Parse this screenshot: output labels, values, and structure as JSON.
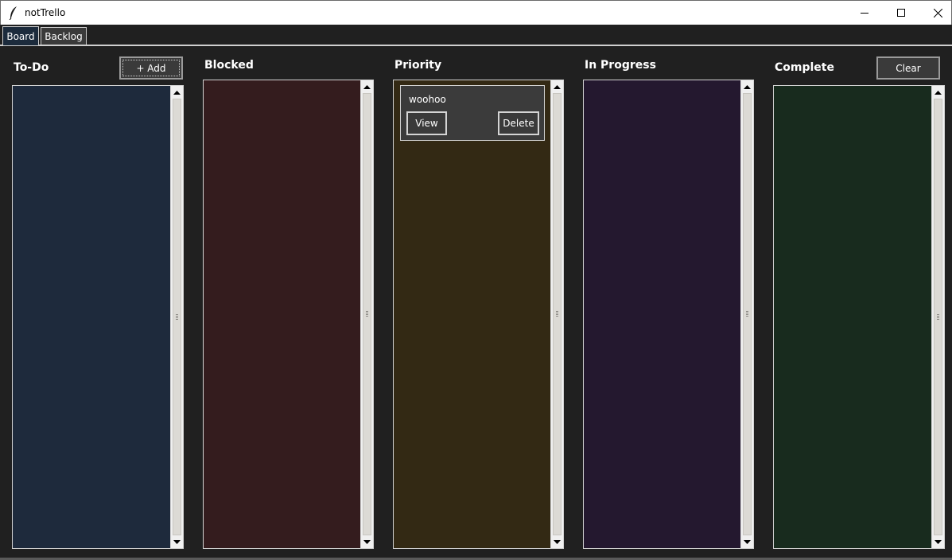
{
  "window": {
    "title": "notTrello",
    "controls": {
      "minimize": "minimize-icon",
      "maximize": "maximize-icon",
      "close": "close-icon"
    }
  },
  "tabs": [
    {
      "label": "Board",
      "selected": true
    },
    {
      "label": "Backlog",
      "selected": false
    }
  ],
  "columns": [
    {
      "title": "To-Do",
      "color": "#1e2a3c",
      "button": "+ Add",
      "cards": []
    },
    {
      "title": "Blocked",
      "color": "#341c1e",
      "cards": []
    },
    {
      "title": "Priority",
      "color": "#332914",
      "cards": [
        {
          "title": "woohoo",
          "view_label": "View",
          "delete_label": "Delete"
        }
      ]
    },
    {
      "title": "In Progress",
      "color": "#24182f",
      "cards": []
    },
    {
      "title": "Complete",
      "color": "#182b1e",
      "button": "Clear",
      "cards": []
    }
  ]
}
